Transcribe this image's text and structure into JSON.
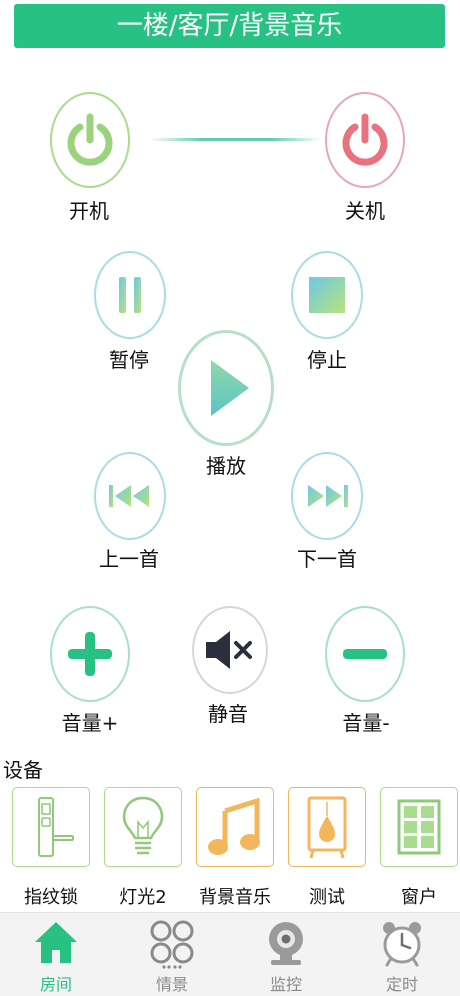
{
  "header": {
    "title": "一楼/客厅/背景音乐"
  },
  "controls": {
    "power_on": "开机",
    "power_off": "关机",
    "pause": "暂停",
    "stop": "停止",
    "play": "播放",
    "prev": "上一首",
    "next": "下一首",
    "volume_up": "音量+",
    "mute": "静音",
    "volume_down": "音量-"
  },
  "devices": {
    "title": "设备",
    "items": [
      {
        "label": "指纹锁",
        "icon": "fingerprint-lock-icon"
      },
      {
        "label": "灯光2",
        "icon": "light-bulb-icon"
      },
      {
        "label": "背景音乐",
        "icon": "music-note-icon"
      },
      {
        "label": "测试",
        "icon": "lamp-icon"
      },
      {
        "label": "窗户",
        "icon": "window-icon"
      }
    ]
  },
  "tabs": [
    {
      "label": "房间",
      "icon": "house-icon",
      "active": true
    },
    {
      "label": "情景",
      "icon": "scene-circles-icon"
    },
    {
      "label": "监控",
      "icon": "camera-icon"
    },
    {
      "label": "定时",
      "icon": "alarm-clock-icon"
    }
  ],
  "colors": {
    "accent": "#27c184",
    "power_on": "#9bd27e",
    "power_off": "#e8737f",
    "music_orange": "#f4b65a",
    "teal_gradient_start": "#6cc8e6",
    "teal_gradient_end": "#b9e27b"
  }
}
